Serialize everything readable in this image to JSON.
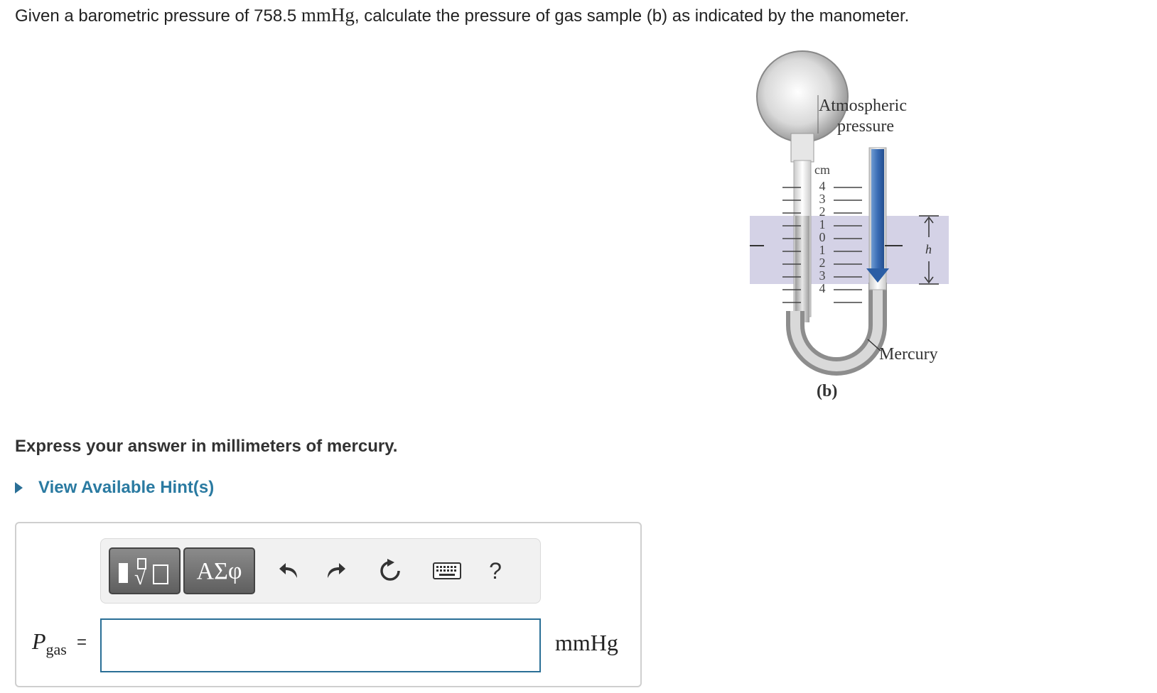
{
  "question": {
    "prefix": "Given a barometric pressure of 758.5 ",
    "unit": "mmHg",
    "suffix": ", calculate the pressure of gas sample (b) as indicated by the manometer."
  },
  "figure": {
    "label_atmospheric_1": "Atmospheric",
    "label_atmospheric_2": "pressure",
    "label_cm": "cm",
    "scale_ticks": [
      "4",
      "3",
      "2",
      "1",
      "0",
      "1",
      "2",
      "3",
      "4"
    ],
    "label_h": "h",
    "label_mercury": "Mercury",
    "label_b": "(b)"
  },
  "instructions": "Express your answer in millimeters of mercury.",
  "hint_link": "View Available Hint(s)",
  "toolbar": {
    "symbols_label": "ΑΣφ",
    "help_label": "?"
  },
  "answer": {
    "variable": "P",
    "subscript": "gas",
    "equals": "=",
    "value": "",
    "unit": "mmHg"
  },
  "colors": {
    "link": "#2a7aa1",
    "input_border": "#2a6f96",
    "band": "#d4d2e6",
    "arrow": "#2b5ea5"
  }
}
